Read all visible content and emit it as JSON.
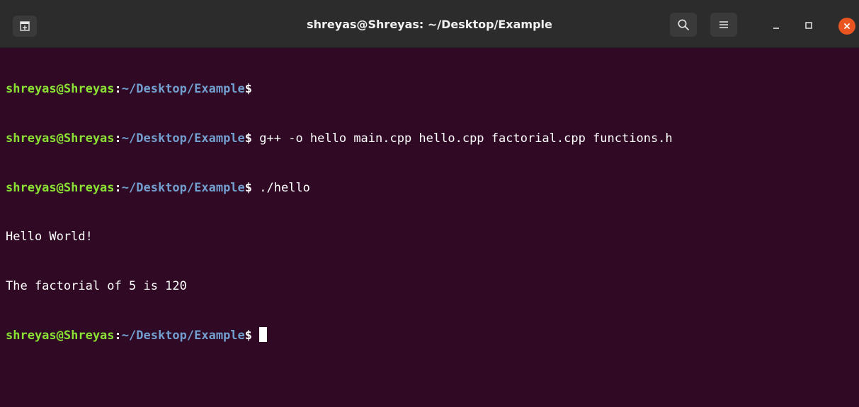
{
  "window": {
    "title": "shreyas@Shreyas: ~/Desktop/Example"
  },
  "titlebar": {
    "new_tab_icon": "new-tab-icon",
    "search_icon": "search-icon",
    "menu_icon": "hamburger-menu-icon",
    "minimize_icon": "minimize-icon",
    "maximize_icon": "maximize-icon",
    "close_icon": "close-icon",
    "close_color": "#e95420"
  },
  "terminal": {
    "colors": {
      "background": "#300a24",
      "user": "#8ae234",
      "path": "#729fcf",
      "text": "#ffffff"
    },
    "prompt": {
      "user_host": "shreyas@Shreyas",
      "separator": ":",
      "path": "~/Desktop/Example",
      "symbol": "$"
    },
    "lines": [
      {
        "type": "prompt",
        "command": ""
      },
      {
        "type": "prompt",
        "command": " g++ -o hello main.cpp hello.cpp factorial.cpp functions.h"
      },
      {
        "type": "prompt",
        "command": " ./hello"
      },
      {
        "type": "output",
        "text": "Hello World!"
      },
      {
        "type": "output",
        "text": "The factorial of 5 is 120"
      },
      {
        "type": "prompt",
        "command": " "
      }
    ]
  }
}
